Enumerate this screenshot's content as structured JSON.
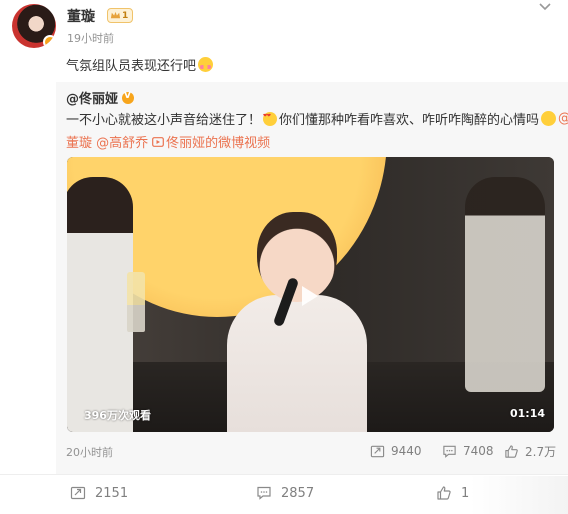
{
  "post": {
    "author": "董璇",
    "level": "1",
    "time": "19小时前",
    "text": "气氛组队员表现还行吧"
  },
  "repost": {
    "author": "@佟丽娅",
    "text_line1_part1": "一不小心就被这小声音给迷住了！",
    "text_line1_part2": "你们懂那种咋看咋喜欢、咋听咋陶醉的心情吗",
    "mention_tail": "@",
    "mention1": "董璇",
    "mention2": "@高舒乔",
    "video_link": "佟丽娅的微博视频",
    "video": {
      "views": "396万次观看",
      "duration": "01:14"
    },
    "time": "20小时前",
    "reposts": "9440",
    "comments": "7408",
    "likes": "2.7万"
  },
  "actions": {
    "reposts": "2151",
    "comments": "2857",
    "likes": "1"
  },
  "colors": {
    "link": "#eb7350",
    "muted": "#939393",
    "vip": "#f7a51c"
  }
}
